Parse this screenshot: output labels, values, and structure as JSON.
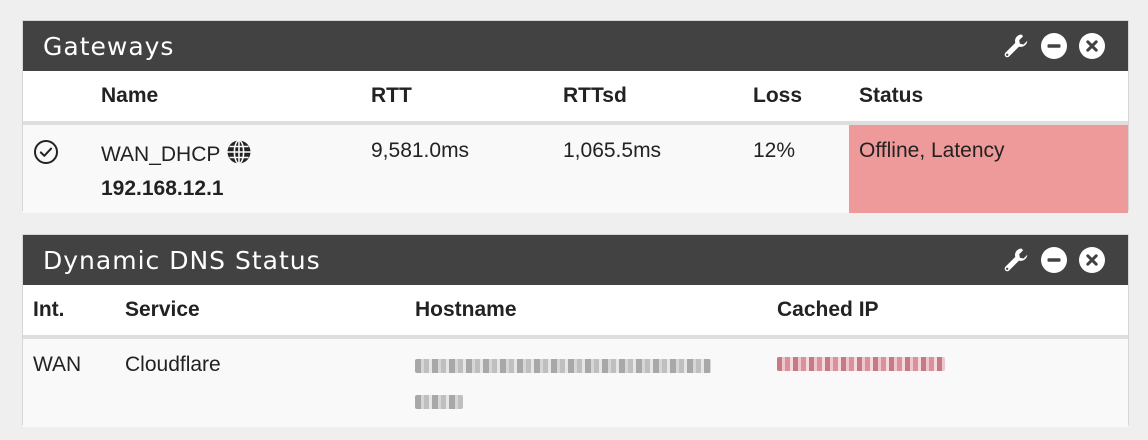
{
  "gateways": {
    "title": "Gateways",
    "columns": [
      "Name",
      "RTT",
      "RTTsd",
      "Loss",
      "Status"
    ],
    "rows": [
      {
        "name": "WAN_DHCP",
        "ip": "192.168.12.1",
        "rtt": "9,581.0ms",
        "rttsd": "1,065.5ms",
        "loss": "12%",
        "status": "Offline, Latency"
      }
    ]
  },
  "dyndns": {
    "title": "Dynamic DNS Status",
    "columns": [
      "Int.",
      "Service",
      "Hostname",
      "Cached IP"
    ],
    "rows": [
      {
        "interface": "WAN",
        "service": "Cloudflare"
      }
    ]
  },
  "colors": {
    "heading_bg": "#424242",
    "status_offline": "#ef9a9a",
    "page_bg": "#efefef"
  },
  "icons": {
    "settings": "wrench-icon",
    "minimize": "minus-circle-icon",
    "close": "close-circle-icon",
    "default_gateway": "check-circle-icon",
    "gateway_type": "globe-icon"
  }
}
